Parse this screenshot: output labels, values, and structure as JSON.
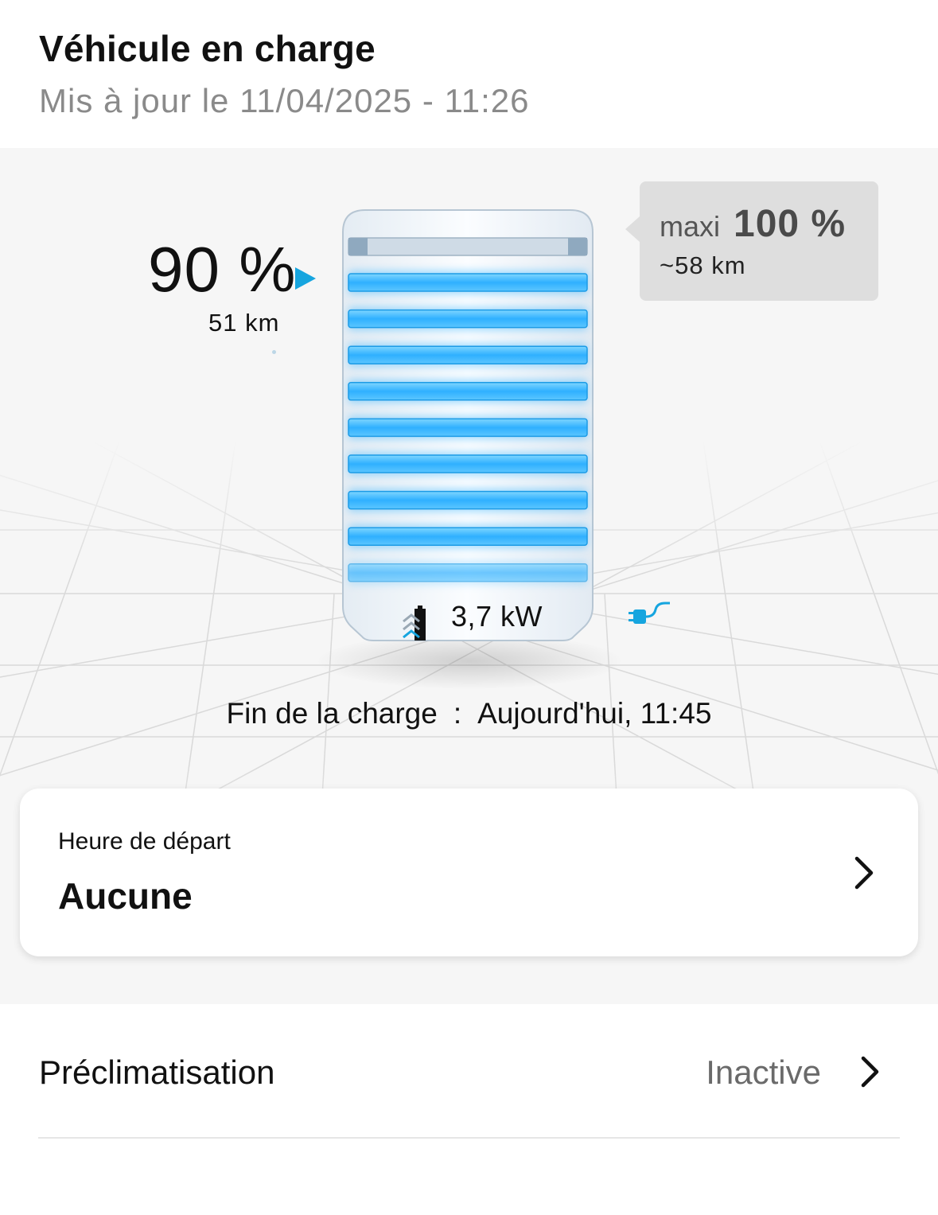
{
  "header": {
    "title": "Véhicule en charge",
    "updated": "Mis à jour le 11/04/2025 - 11:26"
  },
  "battery": {
    "soc_text": "90 %",
    "soc_percent": 90,
    "range": "51 km",
    "power": "3,7 kW",
    "accent_color": "#16a5df",
    "icons": [
      "charging-battery-icon",
      "plug-icon"
    ]
  },
  "max_tooltip": {
    "label": "maxi",
    "value": "100 %",
    "range": "~58 km"
  },
  "end_of_charge": {
    "label": "Fin de la charge",
    "separator": ":",
    "value": "Aujourd'hui, 11:45"
  },
  "departure": {
    "label": "Heure de départ",
    "value": "Aucune"
  },
  "preclimatisation": {
    "label": "Préclimatisation",
    "value": "Inactive"
  }
}
